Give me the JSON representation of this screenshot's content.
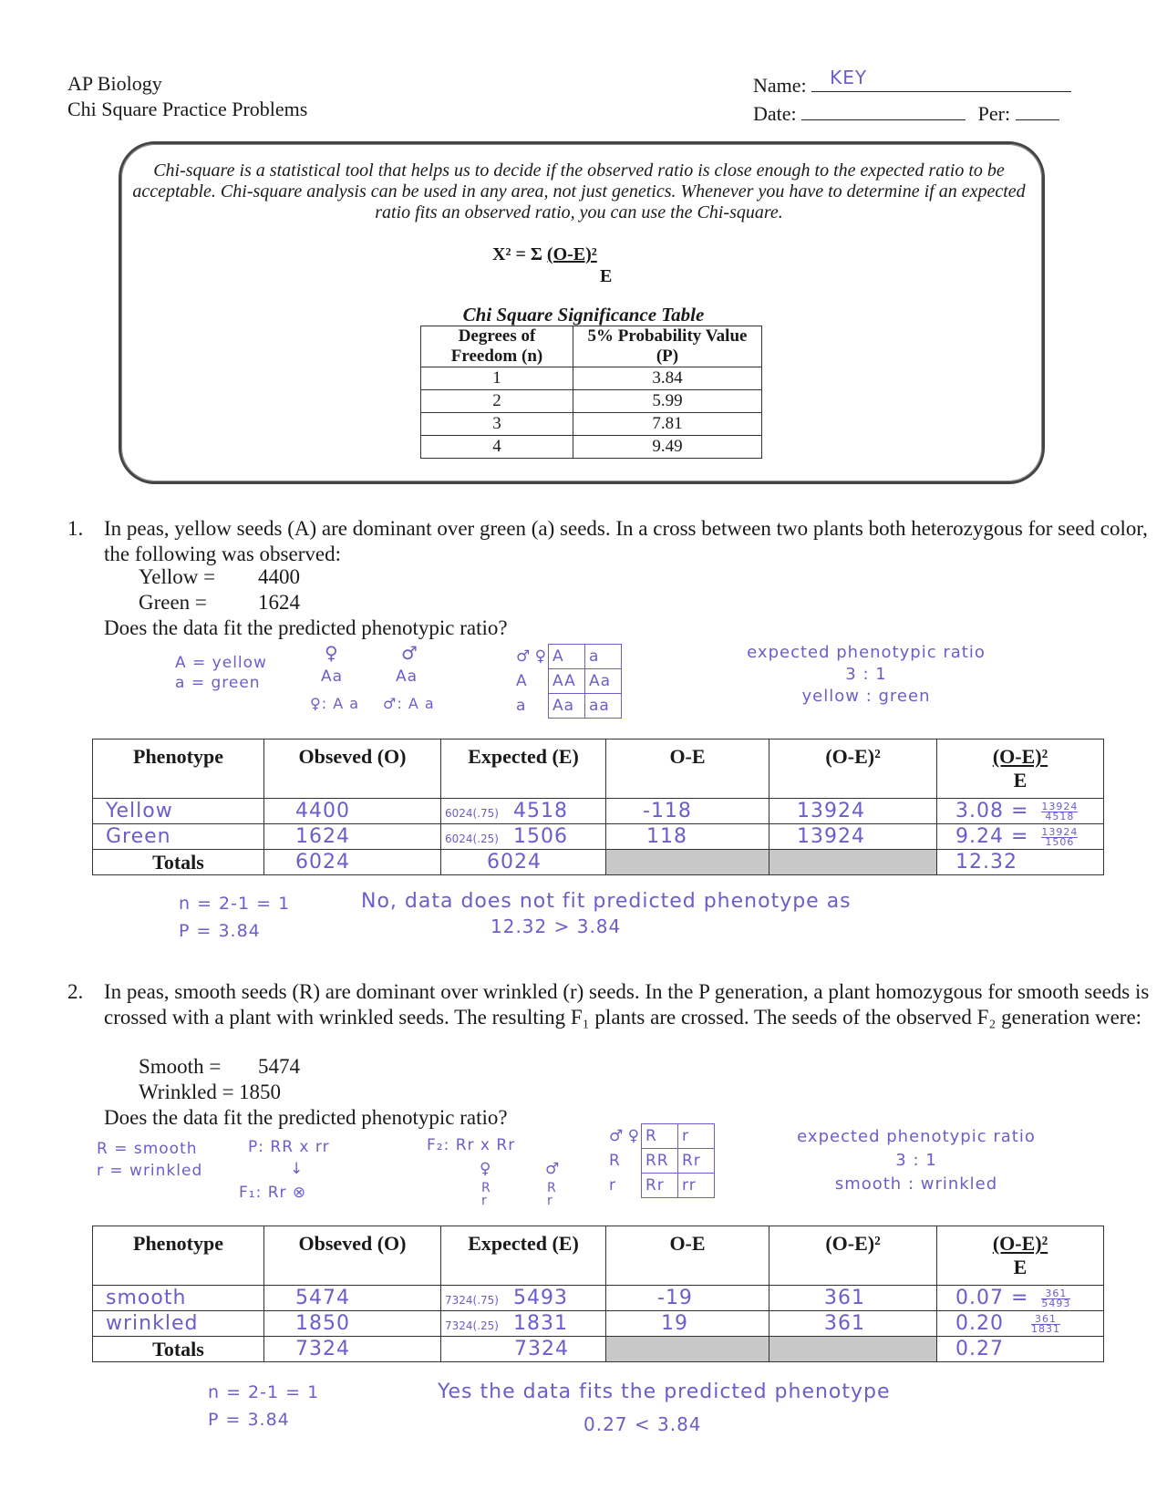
{
  "header": {
    "course": "AP Biology",
    "title": "Chi Square Practice Problems",
    "name_label": "Name:",
    "name_value": "KEY",
    "date_label": "Date:",
    "per_label": "Per:"
  },
  "intro": {
    "text": "Chi-square is a statistical tool that helps us to decide if the observed ratio is close enough to the expected ratio to be acceptable. Chi-square analysis can be used in any area, not just genetics. Whenever you have to determine if an expected ratio fits an observed ratio, you can use the Chi-square.",
    "formula_left": "X² = Σ ",
    "formula_num": "(O-E)²",
    "formula_den": "E"
  },
  "significance_table": {
    "title": "Chi Square Significance Table",
    "headers": [
      "Degrees of Freedom (n)",
      "5% Probability Value (P)"
    ],
    "rows": [
      [
        "1",
        "3.84"
      ],
      [
        "2",
        "5.99"
      ],
      [
        "3",
        "7.81"
      ],
      [
        "4",
        "9.49"
      ]
    ]
  },
  "chi_table_headers": {
    "phenotype": "Phenotype",
    "observed": "Obseved (O)",
    "expected": "Expected (E)",
    "o_minus_e": "O-E",
    "o_minus_e_sq": "(O-E)²",
    "ratio_num": "(O-E)²",
    "ratio_den": "E",
    "totals": "Totals"
  },
  "q1": {
    "number": "1.",
    "text": "In peas, yellow seeds (A) are dominant over green (a) seeds. In a cross between two plants both heterozygous for seed color, the following was observed:",
    "obs": [
      {
        "label": "Yellow =",
        "value": "4400"
      },
      {
        "label": "Green =",
        "value": "1624"
      }
    ],
    "question": "Does the data fit the predicted phenotypic ratio?",
    "work": {
      "key1": "A = yellow",
      "key2": "a = green",
      "female_sym": "♀",
      "male_sym": "♂",
      "female_geno": "Aa",
      "male_geno": "Aa",
      "female_gametes": "♀: A a",
      "male_gametes": "♂: A a",
      "punnett": {
        "corner": "♂ ♀",
        "cols": [
          "A",
          "a"
        ],
        "rows": [
          {
            "label": "A",
            "cells": [
              "AA",
              "Aa"
            ]
          },
          {
            "label": "a",
            "cells": [
              "Aa",
              "aa"
            ]
          }
        ]
      },
      "expected_title": "expected phenotypic ratio",
      "expected_ratio": "3 : 1",
      "expected_labels": "yellow : green"
    },
    "rows": [
      {
        "phenotype": "Yellow",
        "observed": "4400",
        "expected_calc": "6024(.75)",
        "expected": "4518",
        "o_e": "-118",
        "o_e_sq": "13924",
        "ratio": "3.08",
        "ratio_num": "13924",
        "ratio_den": "4518"
      },
      {
        "phenotype": "Green",
        "observed": "1624",
        "expected_calc": "6024(.25)",
        "expected": "1506",
        "o_e": "118",
        "o_e_sq": "13924",
        "ratio": "9.24",
        "ratio_num": "13924",
        "ratio_den": "1506"
      }
    ],
    "totals": {
      "observed": "6024",
      "expected": "6024",
      "chi": "12.32"
    },
    "df": "n = 2-1 = 1",
    "p": "P = 3.84",
    "conclusion": "No, data does not fit predicted phenotype as",
    "comparison": "12.32 > 3.84"
  },
  "q2": {
    "number": "2.",
    "text": "In peas, smooth seeds (R) are dominant over wrinkled (r) seeds. In the P generation, a plant homozygous for smooth seeds is crossed with a plant with wrinkled seeds. The resulting F₁ plants are crossed. The seeds of the observed F₂ generation were:",
    "obs": [
      {
        "label": "Smooth =",
        "value": "5474"
      },
      {
        "label": "Wrinkled =",
        "value": "1850"
      }
    ],
    "question": "Does the data fit the predicted phenotypic ratio?",
    "work": {
      "key1": "R = smooth",
      "key2": "r = wrinkled",
      "p_cross": "P: RR x rr",
      "arrow": "↓",
      "f1": "F₁: Rr ⊗",
      "f2": "F₂: Rr x Rr",
      "female_sym": "♀",
      "male_sym": "♂",
      "female_gametes": "R r",
      "male_gametes": "R r",
      "punnett": {
        "corner": "♂ ♀",
        "cols": [
          "R",
          "r"
        ],
        "rows": [
          {
            "label": "R",
            "cells": [
              "RR",
              "Rr"
            ]
          },
          {
            "label": "r",
            "cells": [
              "Rr",
              "rr"
            ]
          }
        ]
      },
      "expected_title": "expected phenotypic ratio",
      "expected_ratio": "3 : 1",
      "expected_labels": "smooth : wrinkled"
    },
    "rows": [
      {
        "phenotype": "smooth",
        "observed": "5474",
        "expected_calc": "7324(.75)",
        "expected": "5493",
        "o_e": "-19",
        "o_e_sq": "361",
        "ratio": "0.07",
        "ratio_num": "361",
        "ratio_den": "5493"
      },
      {
        "phenotype": "wrinkled",
        "observed": "1850",
        "expected_calc": "7324(.25)",
        "expected": "1831",
        "o_e": "19",
        "o_e_sq": "361",
        "ratio": "0.20",
        "ratio_num": "361",
        "ratio_den": "1831"
      }
    ],
    "totals": {
      "observed": "7324",
      "expected": "7324",
      "chi": "0.27"
    },
    "df": "n = 2-1 = 1",
    "p": "P = 3.84",
    "conclusion": "Yes the data fits the predicted phenotype",
    "comparison": "0.27 < 3.84"
  }
}
